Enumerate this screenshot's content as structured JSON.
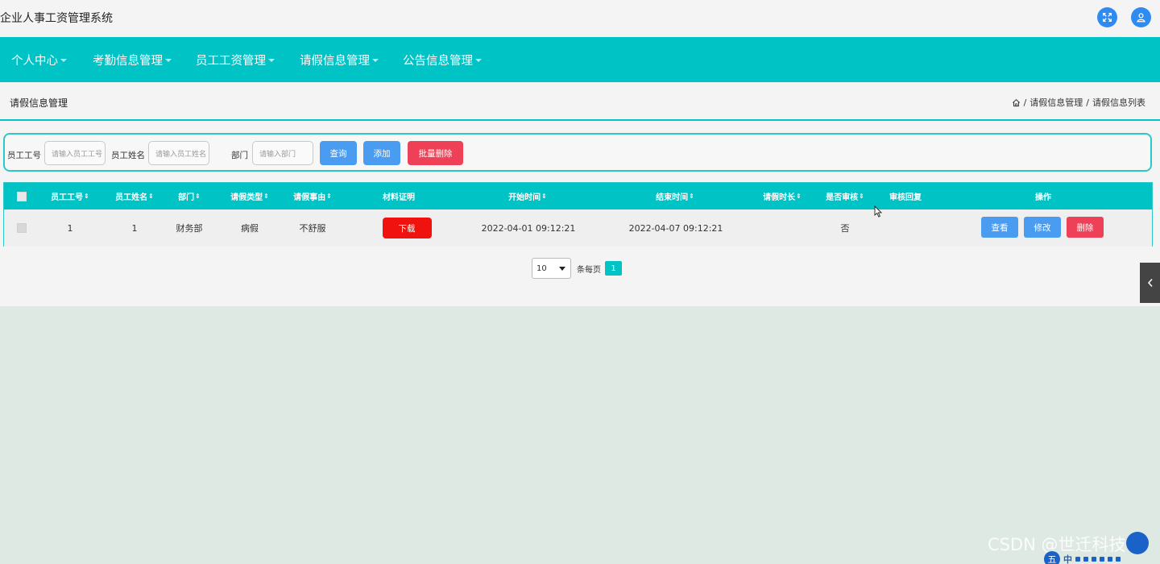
{
  "app": {
    "title": "企业人事工资管理系统"
  },
  "header_icons": [
    "fullscreen-icon",
    "user-icon"
  ],
  "nav": [
    {
      "label": "个人中心"
    },
    {
      "label": "考勤信息管理"
    },
    {
      "label": "员工工资管理"
    },
    {
      "label": "请假信息管理"
    },
    {
      "label": "公告信息管理"
    }
  ],
  "page": {
    "title": "请假信息管理"
  },
  "breadcrumb": {
    "items": [
      "请假信息管理",
      "请假信息列表"
    ],
    "separator": "/"
  },
  "search": {
    "emp_no_label": "员工工号",
    "emp_no_placeholder": "请输入员工工号",
    "emp_name_label": "员工姓名",
    "emp_name_placeholder": "请输入员工姓名",
    "dept_label": "部门",
    "dept_placeholder": "请输入部门",
    "query": "查询",
    "add": "添加",
    "batch_delete": "批量删除"
  },
  "table": {
    "columns": [
      "员工工号",
      "员工姓名",
      "部门",
      "请假类型",
      "请假事由",
      "材料证明",
      "开始时间",
      "结束时间",
      "请假时长",
      "是否审核",
      "审核回复",
      "操作"
    ],
    "sort_glyph": "⇕",
    "rows": [
      {
        "emp_no": "1",
        "emp_name": "1",
        "dept": "财务部",
        "leave_type": "病假",
        "reason": "不舒服",
        "material": "下载",
        "start": "2022-04-01 09:12:21",
        "end": "2022-04-07 09:12:21",
        "duration": "",
        "approved": "否",
        "reply": "",
        "actions": {
          "view": "查看",
          "edit": "修改",
          "delete": "删除"
        }
      }
    ]
  },
  "pagination": {
    "page_size": "10",
    "per_page_label": "条每页",
    "current_page": "1"
  },
  "watermark": "CSDN @世迁科技",
  "ime": {
    "badge": "五",
    "text": "中"
  },
  "colors": {
    "primary": "#00c3c6",
    "blue": "#4a9cf1",
    "red": "#ee4056",
    "download": "#f0120e"
  }
}
